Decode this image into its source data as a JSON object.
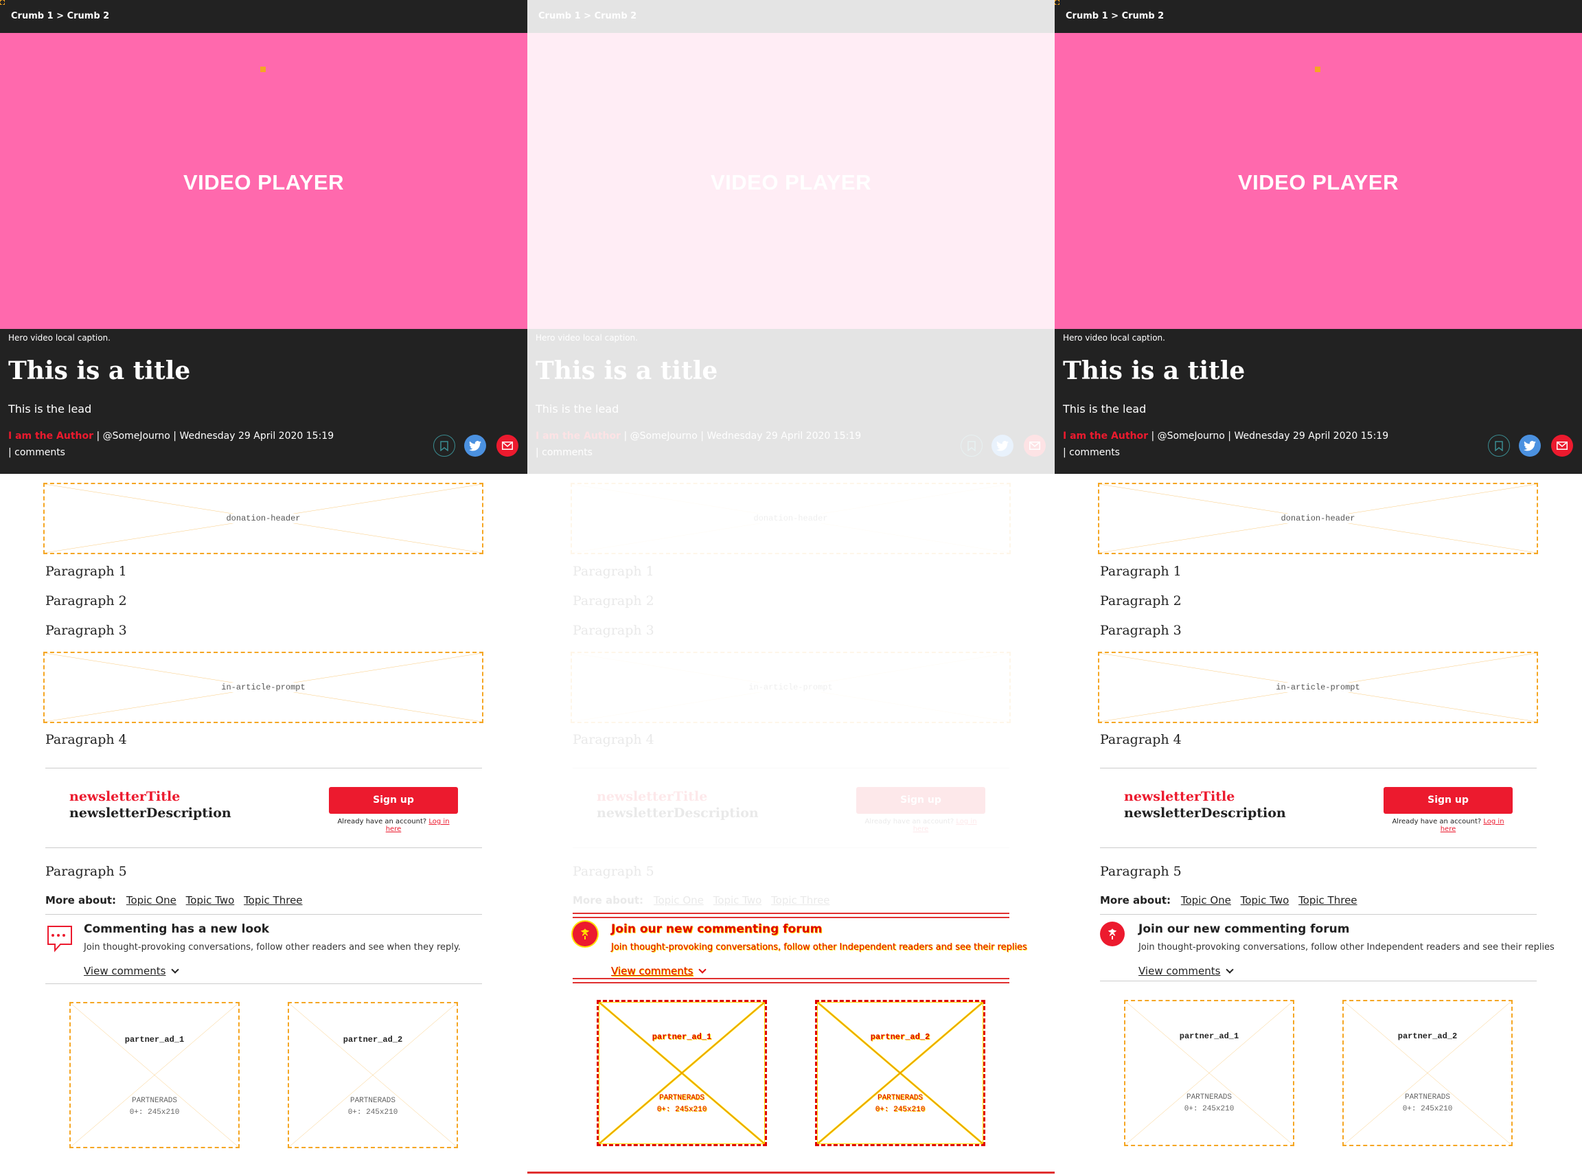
{
  "breadcrumb": "Crumb 1 > Crumb 2",
  "video": {
    "label": "VIDEO PLAYER",
    "caption": "Hero video local caption."
  },
  "article": {
    "title": "This is a title",
    "lead": "This is the lead",
    "author": "I am the Author",
    "byline_rest": " | @SomeJourno | Wednesday 29 April 2020 15:19",
    "comments_line": "|  comments"
  },
  "share_icons": [
    "bookmark-icon",
    "twitter-icon",
    "email-icon"
  ],
  "placeholders": {
    "donation_header": "donation-header",
    "in_article_prompt": "in-article-prompt"
  },
  "paragraphs": {
    "p1": "Paragraph 1",
    "p2": "Paragraph 2",
    "p3": "Paragraph 3",
    "p4": "Paragraph 4",
    "p5": "Paragraph 5"
  },
  "newsletter": {
    "title": "newsletterTitle",
    "description": "newsletterDescription",
    "signup": "Sign up",
    "already": "Already have an account?",
    "login": "Log in here"
  },
  "more_about": {
    "label": "More about:",
    "topics": [
      "Topic One",
      "Topic Two",
      "Topic Three"
    ]
  },
  "commenting_old": {
    "title": "Commenting has a new look",
    "description": "Join thought-provoking conversations, follow other readers and see when they reply.",
    "view": "View comments"
  },
  "commenting_new": {
    "title": "Join our new commenting forum",
    "description": "Join thought-provoking conversations, follow other Independent readers and see their replies",
    "view": "View comments"
  },
  "ads": [
    {
      "name": "partner_ad_1",
      "meta1": "PARTNERADS",
      "meta2": "0+: 245x210"
    },
    {
      "name": "partner_ad_2",
      "meta1": "PARTNERADS",
      "meta2": "0+: 245x210"
    }
  ],
  "colors": {
    "brand_red": "#ec1a2e",
    "dark": "#222222",
    "video_pink": "#ff69ad",
    "placeholder_orange": "#f5a623",
    "twitter_blue": "#4b91e0"
  }
}
